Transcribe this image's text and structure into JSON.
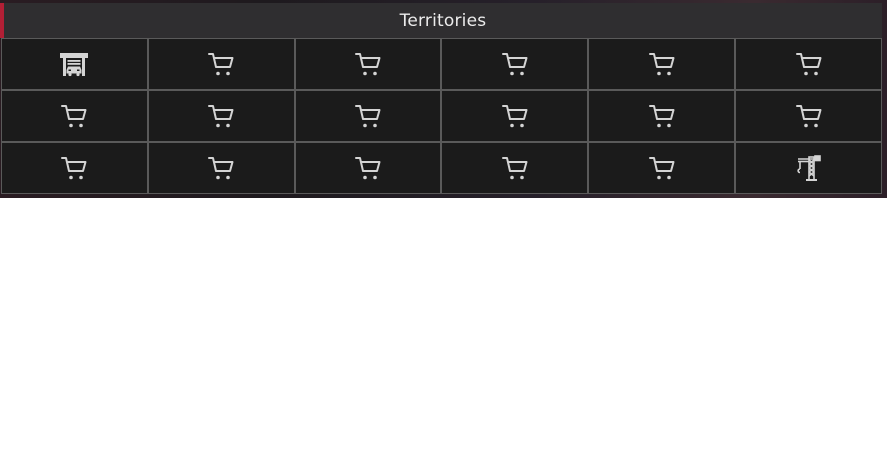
{
  "panel": {
    "title": "Territories"
  },
  "colors": {
    "accent": "#b21f35",
    "header_bg": "#2f2e30",
    "cell_bg": "#1b1b1b",
    "grid_line": "#5a5a5a",
    "icon": "#d4d4d4"
  },
  "grid": {
    "rows": 3,
    "columns": 6,
    "cells": [
      {
        "icon": "garage-icon"
      },
      {
        "icon": "shopping-cart-icon"
      },
      {
        "icon": "shopping-cart-icon"
      },
      {
        "icon": "shopping-cart-icon"
      },
      {
        "icon": "shopping-cart-icon"
      },
      {
        "icon": "shopping-cart-icon"
      },
      {
        "icon": "shopping-cart-icon"
      },
      {
        "icon": "shopping-cart-icon"
      },
      {
        "icon": "shopping-cart-icon"
      },
      {
        "icon": "shopping-cart-icon"
      },
      {
        "icon": "shopping-cart-icon"
      },
      {
        "icon": "shopping-cart-icon"
      },
      {
        "icon": "shopping-cart-icon"
      },
      {
        "icon": "shopping-cart-icon"
      },
      {
        "icon": "shopping-cart-icon"
      },
      {
        "icon": "shopping-cart-icon"
      },
      {
        "icon": "shopping-cart-icon"
      },
      {
        "icon": "construction-crane-icon"
      }
    ]
  }
}
